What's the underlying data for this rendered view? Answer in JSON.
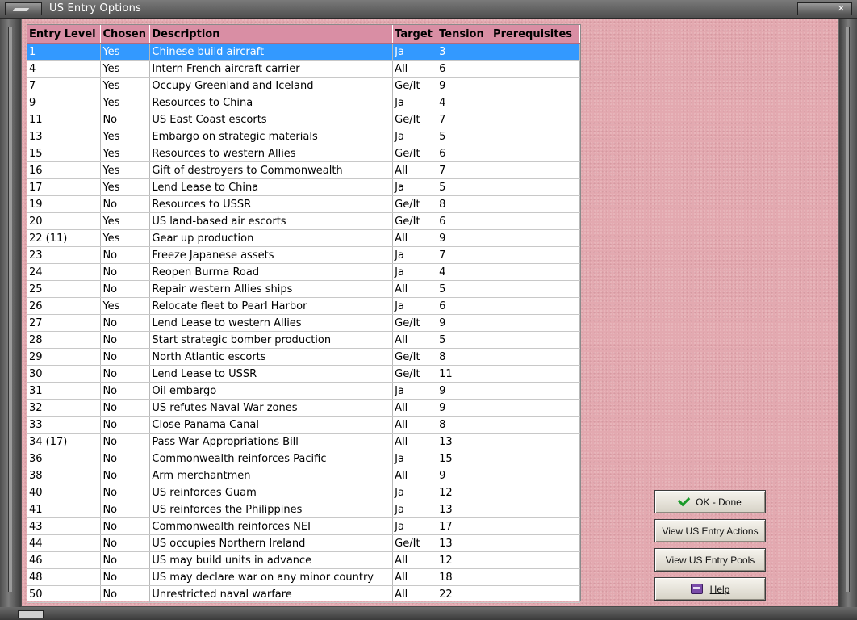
{
  "window": {
    "title": "US Entry Options",
    "close_glyph": "✕"
  },
  "table": {
    "columns": [
      "Entry Level",
      "Chosen",
      "Description",
      "Target",
      "Tension",
      "Prerequisites"
    ],
    "selected_index": 0,
    "rows": [
      [
        "1",
        "Yes",
        "Chinese build aircraft",
        "Ja",
        "3",
        ""
      ],
      [
        "4",
        "Yes",
        "Intern French aircraft carrier",
        "All",
        "6",
        ""
      ],
      [
        "7",
        "Yes",
        "Occupy Greenland and Iceland",
        "Ge/It",
        "9",
        ""
      ],
      [
        "9",
        "Yes",
        "Resources to China",
        "Ja",
        "4",
        ""
      ],
      [
        "11",
        "No",
        "US East Coast escorts",
        "Ge/It",
        "7",
        ""
      ],
      [
        "13",
        "Yes",
        "Embargo on strategic materials",
        "Ja",
        "5",
        ""
      ],
      [
        "15",
        "Yes",
        "Resources to western Allies",
        "Ge/It",
        "6",
        ""
      ],
      [
        "16",
        "Yes",
        "Gift of destroyers to Commonwealth",
        "All",
        "7",
        ""
      ],
      [
        "17",
        "Yes",
        "Lend Lease to China",
        "Ja",
        "5",
        ""
      ],
      [
        "19",
        "No",
        "Resources to USSR",
        "Ge/It",
        "8",
        ""
      ],
      [
        "20",
        "Yes",
        "US land-based air escorts",
        "Ge/It",
        "6",
        ""
      ],
      [
        "22 (11)",
        "Yes",
        "Gear up production",
        "All",
        "9",
        ""
      ],
      [
        "23",
        "No",
        "Freeze Japanese assets",
        "Ja",
        "7",
        ""
      ],
      [
        "24",
        "No",
        "Reopen Burma Road",
        "Ja",
        "4",
        ""
      ],
      [
        "25",
        "No",
        "Repair western Allies ships",
        "All",
        "5",
        ""
      ],
      [
        "26",
        "Yes",
        "Relocate fleet to Pearl Harbor",
        "Ja",
        "6",
        ""
      ],
      [
        "27",
        "No",
        "Lend Lease to western Allies",
        "Ge/It",
        "9",
        ""
      ],
      [
        "28",
        "No",
        "Start strategic bomber production",
        "All",
        "5",
        ""
      ],
      [
        "29",
        "No",
        "North Atlantic escorts",
        "Ge/It",
        "8",
        ""
      ],
      [
        "30",
        "No",
        "Lend Lease to USSR",
        "Ge/It",
        "11",
        ""
      ],
      [
        "31",
        "No",
        "Oil embargo",
        "Ja",
        "9",
        ""
      ],
      [
        "32",
        "No",
        "US refutes Naval War zones",
        "All",
        "9",
        ""
      ],
      [
        "33",
        "No",
        "Close Panama Canal",
        "All",
        "8",
        ""
      ],
      [
        "34 (17)",
        "No",
        "Pass War Appropriations Bill",
        "All",
        "13",
        ""
      ],
      [
        "36",
        "No",
        "Commonwealth reinforces Pacific",
        "Ja",
        "15",
        ""
      ],
      [
        "38",
        "No",
        "Arm merchantmen",
        "All",
        "9",
        ""
      ],
      [
        "40",
        "No",
        "US reinforces Guam",
        "Ja",
        "12",
        ""
      ],
      [
        "41",
        "No",
        "US reinforces the Philippines",
        "Ja",
        "13",
        ""
      ],
      [
        "43",
        "No",
        "Commonwealth reinforces NEI",
        "Ja",
        "17",
        ""
      ],
      [
        "44",
        "No",
        "US occupies Northern Ireland",
        "Ge/It",
        "13",
        ""
      ],
      [
        "46",
        "No",
        "US may build units in advance",
        "All",
        "12",
        ""
      ],
      [
        "48",
        "No",
        "US may declare war on any minor country",
        "All",
        "18",
        ""
      ],
      [
        "50",
        "No",
        "Unrestricted naval warfare",
        "All",
        "22",
        ""
      ]
    ]
  },
  "buttons": {
    "ok": {
      "label": "OK - Done",
      "icon": "checkmark-icon",
      "color": "#1a9a2a"
    },
    "view_actions": {
      "label": "View US Entry Actions"
    },
    "view_pools": {
      "label": "View US Entry Pools"
    },
    "help": {
      "label": "Help",
      "icon": "book-icon",
      "color": "#7a4ca8"
    }
  },
  "colors": {
    "background": "#e3a9b0",
    "header": "#d98ea4",
    "selection": "#3399ff"
  }
}
